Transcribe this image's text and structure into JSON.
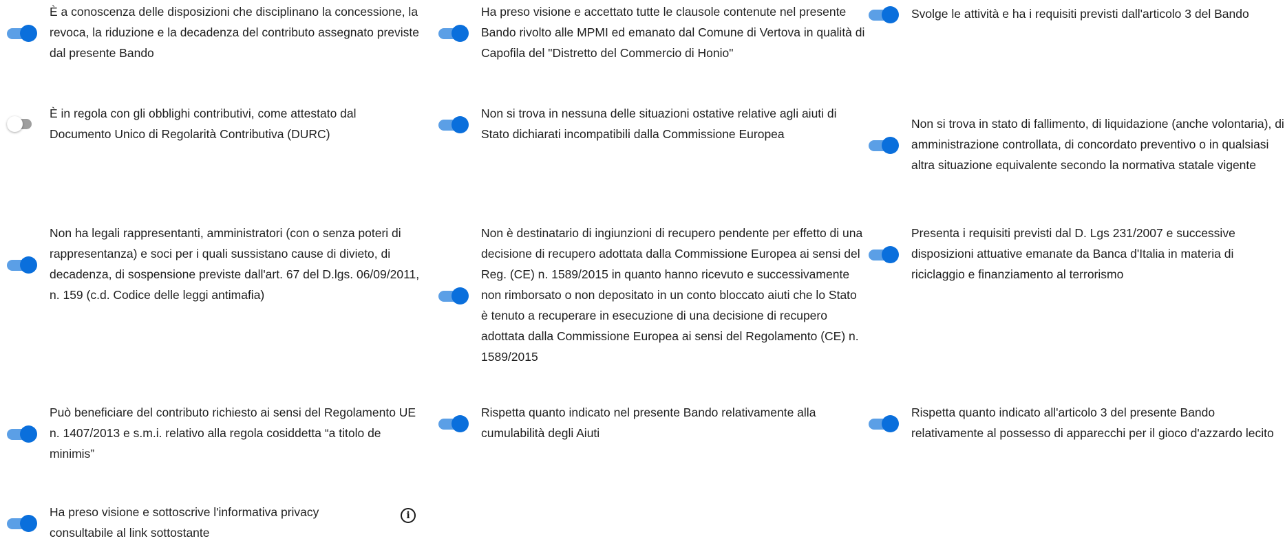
{
  "checks": [
    {
      "text": "È a conoscenza delle disposizioni che disciplinano la concessione, la revoca, la riduzione e la decadenza del contributo assegnato previste dal presente Bando",
      "enabled": true
    },
    {
      "text": "Ha preso visione e accettato tutte le clausole contenute nel presente Bando rivolto alle MPMI ed emanato dal Comune di Vertova in qualità di Capofila del \"Distretto del Commercio di Honio\"",
      "enabled": true
    },
    {
      "text": "Svolge le attività e ha i requisiti previsti dall'articolo 3 del Bando",
      "enabled": true
    },
    {
      "text": "È in regola con gli obblighi contributivi, come attestato dal Documento Unico di Regolarità Contributiva (DURC)",
      "enabled": false
    },
    {
      "text": "Non si trova in nessuna delle situazioni ostative relative agli aiuti di Stato dichiarati incompatibili dalla Commissione Europea",
      "enabled": true
    },
    {
      "text": "Non si trova in stato di fallimento, di liquidazione (anche volontaria), di amministrazione controllata, di concordato preventivo o in qualsiasi altra situazione equivalente secondo la normativa statale vigente",
      "enabled": true
    },
    {
      "text": "Non ha legali rappresentanti, amministratori (con o senza poteri di rappresentanza) e soci per i quali sussistano cause di divieto, di decadenza, di sospensione previste dall'art. 67 del D.lgs. 06/09/2011, n. 159 (c.d. Codice delle leggi antimafia)",
      "enabled": true
    },
    {
      "text": "Non è destinatario di ingiunzioni di recupero pendente per effetto di una decisione di recupero adottata dalla Commissione Europea ai sensi del Reg. (CE) n. 1589/2015 in quanto hanno ricevuto e successivamente non rimborsato o non depositato in un conto bloccato aiuti che lo Stato è tenuto a recuperare in esecuzione di una decisione di recupero adottata dalla Commissione Europea ai sensi del Regolamento (CE) n. 1589/2015",
      "enabled": true
    },
    {
      "text": "Presenta i requisiti previsti dal D. Lgs 231/2007 e successive disposizioni attuative emanate da Banca d'Italia in materia di riciclaggio e finanziamento al terrorismo",
      "enabled": true
    },
    {
      "text": "Può beneficiare del contributo richiesto ai sensi del Regolamento UE n. 1407/2013 e s.m.i. relativo alla regola cosiddetta “a titolo de minimis”",
      "enabled": true
    },
    {
      "text": "Rispetta quanto indicato nel presente Bando relativamente alla cumulabilità degli Aiuti",
      "enabled": true
    },
    {
      "text": "Rispetta quanto indicato all'articolo 3 del presente Bando relativamente al possesso di apparecchi per il gioco d'azzardo lecito",
      "enabled": true
    },
    {
      "text": "Ha preso visione e sottoscrive l'informativa privacy consultabile al link sottostante",
      "enabled": true
    }
  ],
  "colors": {
    "toggle_on_knob": "#0a6fdc",
    "toggle_on_track": "#5b9fe6",
    "toggle_off_track": "#9e9e9e",
    "toggle_off_knob": "#ffffff"
  },
  "icons": {
    "privacy_info": "info-icon"
  }
}
